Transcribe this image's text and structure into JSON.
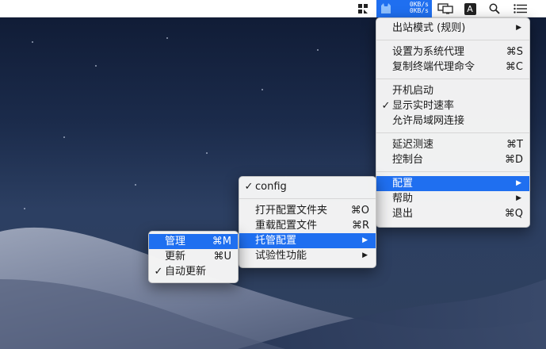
{
  "menubar": {
    "speed_up": "0KB/s",
    "speed_down": "0KB/s",
    "input_badge": "A"
  },
  "main_menu": {
    "items": [
      {
        "label": "出站模式 (规则)",
        "shortcut": "",
        "submenu": true,
        "checked": false
      },
      {
        "label": "设置为系统代理",
        "shortcut": "⌘S",
        "submenu": false,
        "checked": false
      },
      {
        "label": "复制终端代理命令",
        "shortcut": "⌘C",
        "submenu": false,
        "checked": false
      },
      {
        "label": "开机启动",
        "shortcut": "",
        "submenu": false,
        "checked": false
      },
      {
        "label": "显示实时速率",
        "shortcut": "",
        "submenu": false,
        "checked": true
      },
      {
        "label": "允许局域网连接",
        "shortcut": "",
        "submenu": false,
        "checked": false
      },
      {
        "label": "延迟测速",
        "shortcut": "⌘T",
        "submenu": false,
        "checked": false
      },
      {
        "label": "控制台",
        "shortcut": "⌘D",
        "submenu": false,
        "checked": false
      },
      {
        "label": "配置",
        "shortcut": "",
        "submenu": true,
        "checked": false,
        "selected": true
      },
      {
        "label": "帮助",
        "shortcut": "",
        "submenu": true,
        "checked": false
      },
      {
        "label": "退出",
        "shortcut": "⌘Q",
        "submenu": false,
        "checked": false
      }
    ]
  },
  "config_menu": {
    "items": [
      {
        "label": "config",
        "shortcut": "",
        "submenu": false,
        "checked": true
      },
      {
        "label": "打开配置文件夹",
        "shortcut": "⌘O",
        "submenu": false,
        "checked": false
      },
      {
        "label": "重载配置文件",
        "shortcut": "⌘R",
        "submenu": false,
        "checked": false
      },
      {
        "label": "托管配置",
        "shortcut": "",
        "submenu": true,
        "checked": false,
        "selected": true
      },
      {
        "label": "试验性功能",
        "shortcut": "",
        "submenu": true,
        "checked": false
      }
    ]
  },
  "managed_menu": {
    "items": [
      {
        "label": "管理",
        "shortcut": "⌘M",
        "submenu": false,
        "checked": false,
        "selected": true
      },
      {
        "label": "更新",
        "shortcut": "⌘U",
        "submenu": false,
        "checked": false
      },
      {
        "label": "自动更新",
        "shortcut": "",
        "submenu": false,
        "checked": true
      }
    ]
  },
  "glyphs": {
    "check": "✓",
    "arrow": "▶"
  },
  "colors": {
    "highlight": "#1f6ff0",
    "menu_bg": "#f5f5f5",
    "desktop": "#1b2b4b"
  }
}
